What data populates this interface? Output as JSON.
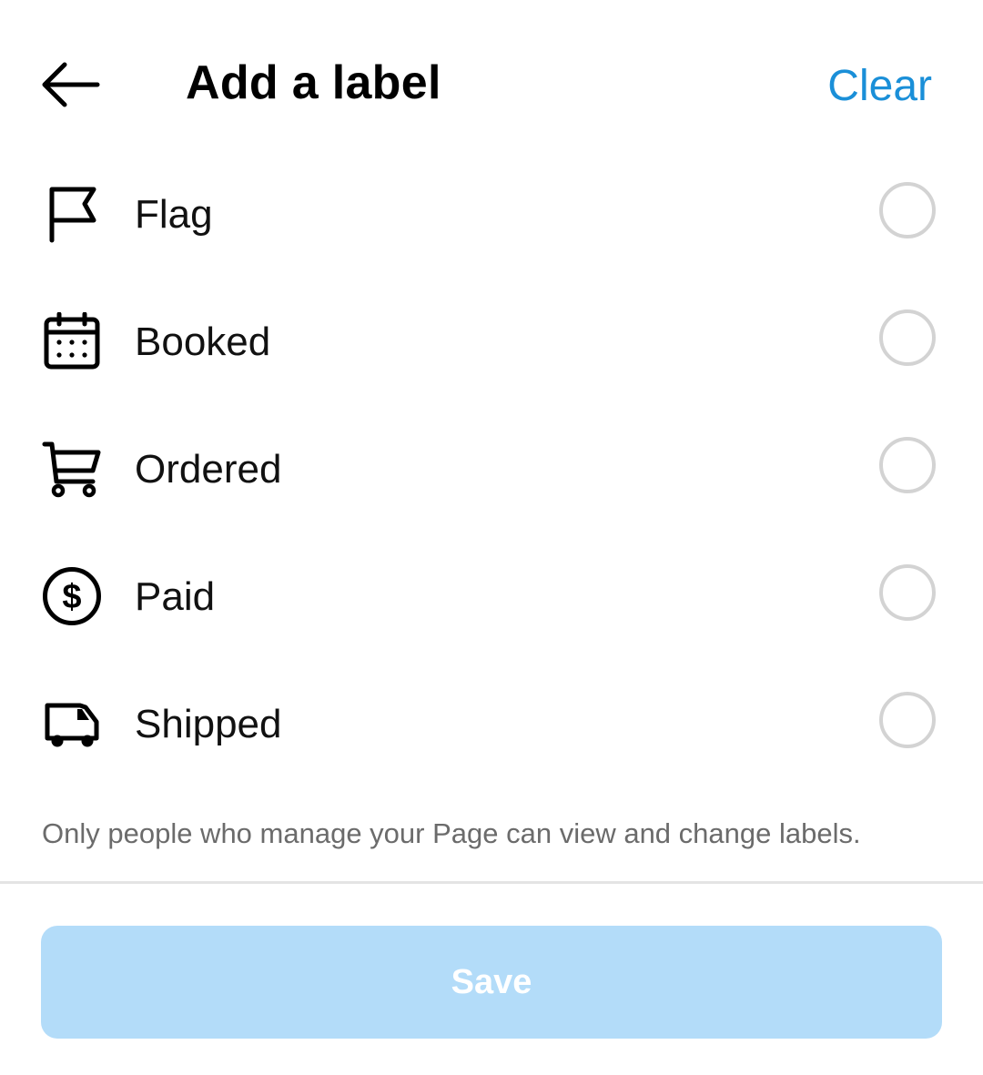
{
  "header": {
    "back_icon": "arrow-left-icon",
    "title": "Add a label",
    "clear_label": "Clear"
  },
  "labels": [
    {
      "label": "Flag",
      "icon": "flag-icon",
      "selected": false
    },
    {
      "label": "Booked",
      "icon": "calendar-icon",
      "selected": false
    },
    {
      "label": "Ordered",
      "icon": "cart-icon",
      "selected": false
    },
    {
      "label": "Paid",
      "icon": "dollar-circle-icon",
      "selected": false
    },
    {
      "label": "Shipped",
      "icon": "truck-icon",
      "selected": false
    }
  ],
  "note": "Only people who manage your Page can view and change labels.",
  "save_label": "Save",
  "colors": {
    "accent": "#1a8fd8",
    "save_bg_disabled": "#b3dcf9",
    "note_text": "#6b6b6b",
    "radio_border": "#d3d3d3"
  }
}
